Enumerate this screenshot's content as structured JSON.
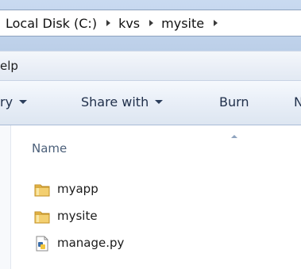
{
  "address_bar": {
    "crumbs": [
      "Local Disk (C:)",
      "kvs",
      "mysite"
    ]
  },
  "menu": {
    "visible_item": "elp"
  },
  "command_bar": {
    "items": [
      {
        "label": "ry"
      },
      {
        "label": "Share with"
      },
      {
        "label": "Burn"
      },
      {
        "label": "N"
      }
    ]
  },
  "columns": {
    "name_header": "Name"
  },
  "files": [
    {
      "name": "myapp",
      "icon": "folder-icon"
    },
    {
      "name": "mysite",
      "icon": "folder-icon"
    },
    {
      "name": "manage.py",
      "icon": "python-file-icon"
    }
  ],
  "colors": {
    "folder": "#e8b84b",
    "address_bg": "#c6d8ef",
    "command_text": "#1f2f4a"
  }
}
